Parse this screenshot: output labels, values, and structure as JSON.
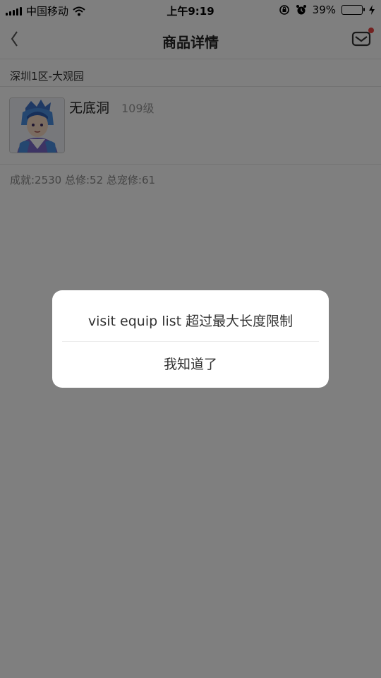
{
  "status_bar": {
    "carrier": "中国移动",
    "time": "上午9:19",
    "battery_percent": "39%",
    "battery_level": 0.39,
    "icons": [
      "signal-icon",
      "wifi-icon",
      "rotation-lock-icon",
      "alarm-icon",
      "battery-icon",
      "charging-icon"
    ]
  },
  "nav": {
    "title": "商品详情",
    "back_icon": "chevron-left-icon",
    "mail_icon": "mail-icon",
    "mail_badge_color": "#e64340"
  },
  "product": {
    "server": "深圳1区-大观园",
    "character_name": "无底洞",
    "level": "109级",
    "stats": "成就:2530 总修:52 总宠修:61"
  },
  "dialog": {
    "message": "visit equip list 超过最大长度限制",
    "confirm_label": "我知道了"
  },
  "colors": {
    "overlay": "#000000",
    "badge": "#e64340",
    "battery_fill": "#4cd964"
  }
}
